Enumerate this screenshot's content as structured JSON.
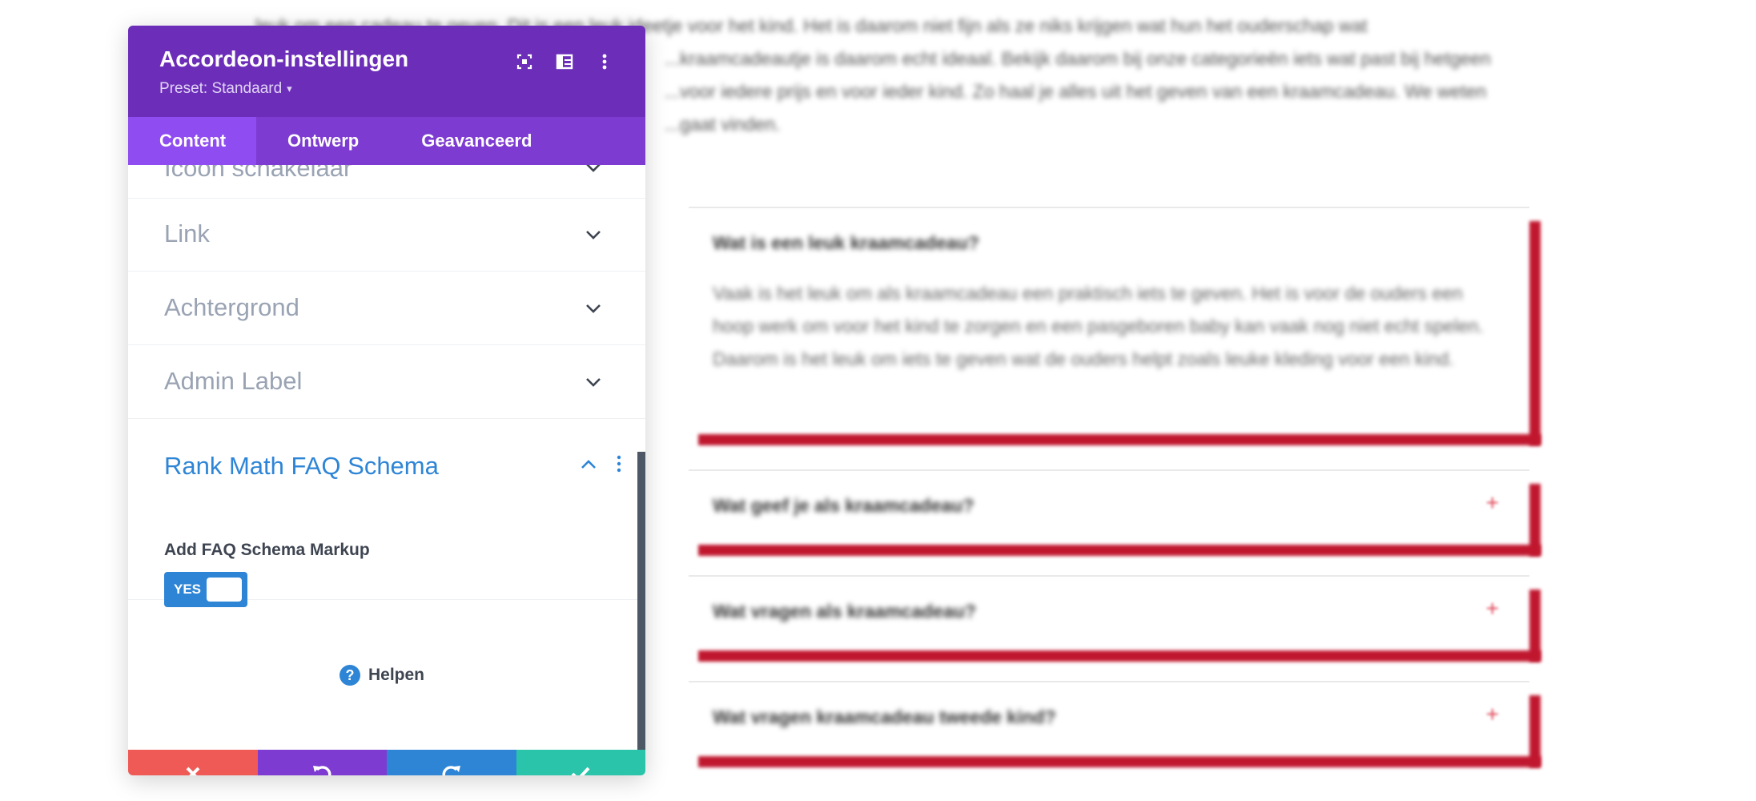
{
  "panel": {
    "title": "Accordeon-instellingen",
    "preset": "Preset: Standaard",
    "tabs": [
      {
        "label": "Content",
        "active": true
      },
      {
        "label": "Ontwerp",
        "active": false
      },
      {
        "label": "Geavanceerd",
        "active": false
      }
    ],
    "sections": [
      {
        "label": "Icoon schakelaar",
        "expanded": false
      },
      {
        "label": "Link",
        "expanded": false
      },
      {
        "label": "Achtergrond",
        "expanded": false
      },
      {
        "label": "Admin Label",
        "expanded": false
      },
      {
        "label": "Rank Math FAQ Schema",
        "expanded": true
      }
    ],
    "faq_field": {
      "label": "Add FAQ Schema Markup",
      "toggle_text": "YES",
      "value": true
    },
    "help_label": "Helpen",
    "footer_buttons": [
      "close-icon",
      "undo-icon",
      "redo-icon",
      "check-icon"
    ],
    "colors": {
      "header": "#6c2eb9",
      "tabs": "#7d3bd1",
      "active_tab": "#8f4cf0",
      "accent_blue": "#2e85d6",
      "cancel": "#ef5a57",
      "undo": "#7d3bd1",
      "redo": "#2e85d6",
      "save": "#29c4a9",
      "accordion_shadow": "#c0172f"
    }
  },
  "background_page": {
    "paragraph_lines": [
      "...leuk om een cadeau te geven. Dit is een leuk ideetje voor het kind. Het is daarom niet fijn als ze niks krijgen wat hun het ouderschap wat",
      "...kraamcadeautje is daarom echt ideaal. Bekijk daarom bij onze categorieën iets wat past bij hetgeen",
      "...voor iedere prijs en voor ieder kind. Zo haal je alles uit het geven van een kraamcadeau. We weten",
      "...gaat vinden."
    ],
    "accordion": [
      {
        "title": "Wat is een leuk kraamcadeau?",
        "open": true,
        "body": "Vaak is het leuk om als kraamcadeau een praktisch iets te geven. Het is voor de ouders een hoop werk om voor het kind te zorgen en een pasgeboren baby kan vaak nog niet echt spelen. Daarom is het leuk om iets te geven wat de ouders helpt zoals leuke kleding voor een kind."
      },
      {
        "title": "Wat geef je als kraamcadeau?",
        "open": false,
        "toggle": "+"
      },
      {
        "title": "Wat vragen als kraamcadeau?",
        "open": false,
        "toggle": "+"
      },
      {
        "title": "Wat vragen kraamcadeau tweede kind?",
        "open": false,
        "toggle": "+"
      }
    ]
  }
}
